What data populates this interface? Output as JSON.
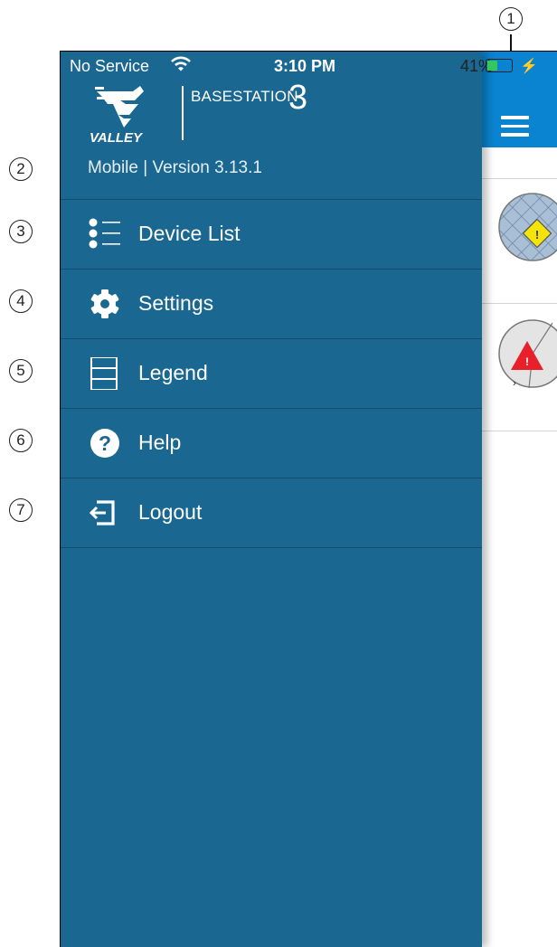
{
  "status_bar": {
    "carrier": "No Service",
    "time": "3:10 PM",
    "battery_percent": "41%",
    "battery_level": 0.41,
    "wifi_icon": "wifi-icon",
    "charging_icon": "bolt-icon"
  },
  "brand": {
    "logo_text": "VALLEY",
    "product": "BASESTATION",
    "product_number": "3"
  },
  "drawer": {
    "version": "Mobile | Version 3.13.1",
    "items": [
      {
        "label": "Device List",
        "icon": "list-icon"
      },
      {
        "label": "Settings",
        "icon": "gear-icon"
      },
      {
        "label": "Legend",
        "icon": "legend-icon"
      },
      {
        "label": "Help",
        "icon": "help-icon"
      },
      {
        "label": "Logout",
        "icon": "logout-icon"
      }
    ]
  },
  "callouts": [
    "1",
    "2",
    "3",
    "4",
    "5",
    "6",
    "7"
  ],
  "colors": {
    "drawer_bg": "#1a6791",
    "topbar_bg": "#0a84d0",
    "warning_yellow": "#f4e40a",
    "alarm_red": "#e8202a"
  }
}
